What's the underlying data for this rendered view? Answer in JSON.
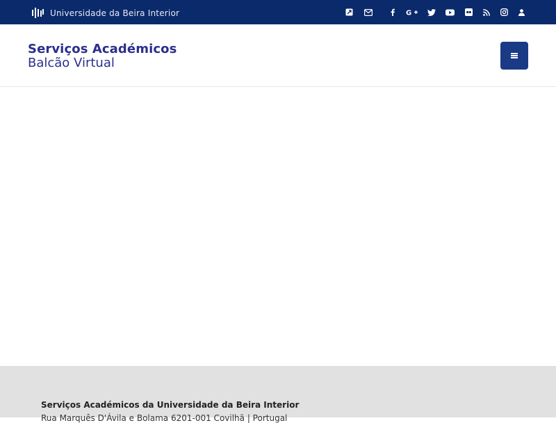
{
  "topbar": {
    "brand": "Universidade da Beira Interior",
    "icons": [
      "external-link-icon",
      "envelope-icon",
      "facebook-icon",
      "google-plus-icon",
      "twitter-icon",
      "youtube-icon",
      "flickr-icon",
      "rss-icon",
      "instagram-icon",
      "user-icon"
    ]
  },
  "header": {
    "title": "Serviços Académicos",
    "subtitle": "Balcão Virtual",
    "menu_icon": "hamburger-menu-icon"
  },
  "footer": {
    "title": "Serviços Académicos da Universidade da Beira Interior",
    "address": "Rua Marquês D'Ávila e Bolama 6201-001 Covilhã | Portugal"
  },
  "colors": {
    "topbar_bg": "#0b2a6b",
    "brand_text": "#2b2f8c",
    "menu_button": "#1a3a86",
    "footer_bg": "#e1e1e1"
  }
}
